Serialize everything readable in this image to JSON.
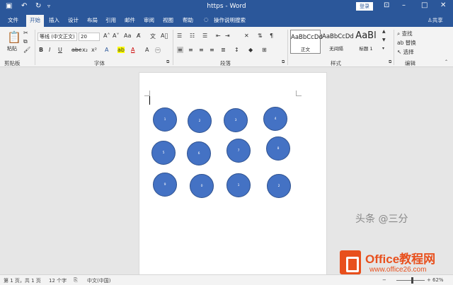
{
  "title": "https - Word",
  "login_label": "登录",
  "window_controls": [
    "–",
    "□",
    "✕"
  ],
  "tabs": [
    {
      "label": "文件",
      "active": false
    },
    {
      "label": "开始",
      "active": true
    },
    {
      "label": "插入",
      "active": false
    },
    {
      "label": "设计",
      "active": false
    },
    {
      "label": "布局",
      "active": false
    },
    {
      "label": "引用",
      "active": false
    },
    {
      "label": "邮件",
      "active": false
    },
    {
      "label": "审阅",
      "active": false
    },
    {
      "label": "视图",
      "active": false
    },
    {
      "label": "帮助",
      "active": false
    }
  ],
  "tell_me": "操作说明搜索",
  "share_label": "共享",
  "ribbon": {
    "clipboard": {
      "paste_label": "粘贴",
      "group_label": "剪贴板"
    },
    "font": {
      "font_name": "等线 (中文正文)",
      "font_size": "20",
      "group_label": "字体"
    },
    "paragraph": {
      "group_label": "段落"
    },
    "styles": {
      "group_label": "样式",
      "items": [
        {
          "sample": "AaBbCcDd",
          "name": "正文"
        },
        {
          "sample": "AaBbCcDd",
          "name": "无间隔"
        },
        {
          "sample": "AaBl",
          "name": "标题 1"
        }
      ]
    },
    "editing": {
      "find": "查找",
      "replace": "替换",
      "select": "选择",
      "group_label": "编辑"
    }
  },
  "circles": [
    "1",
    "2",
    "3",
    "4",
    "5",
    "6",
    "7",
    "8",
    "9",
    "0",
    "1",
    "2"
  ],
  "status": {
    "page": "第 1 页，共 1 页",
    "words": "12 个字",
    "language": "中文(中国)",
    "zoom": "62%"
  },
  "watermark": {
    "brand": "Office教程网",
    "url": "www.office26.com",
    "author": "头条 @三分"
  }
}
